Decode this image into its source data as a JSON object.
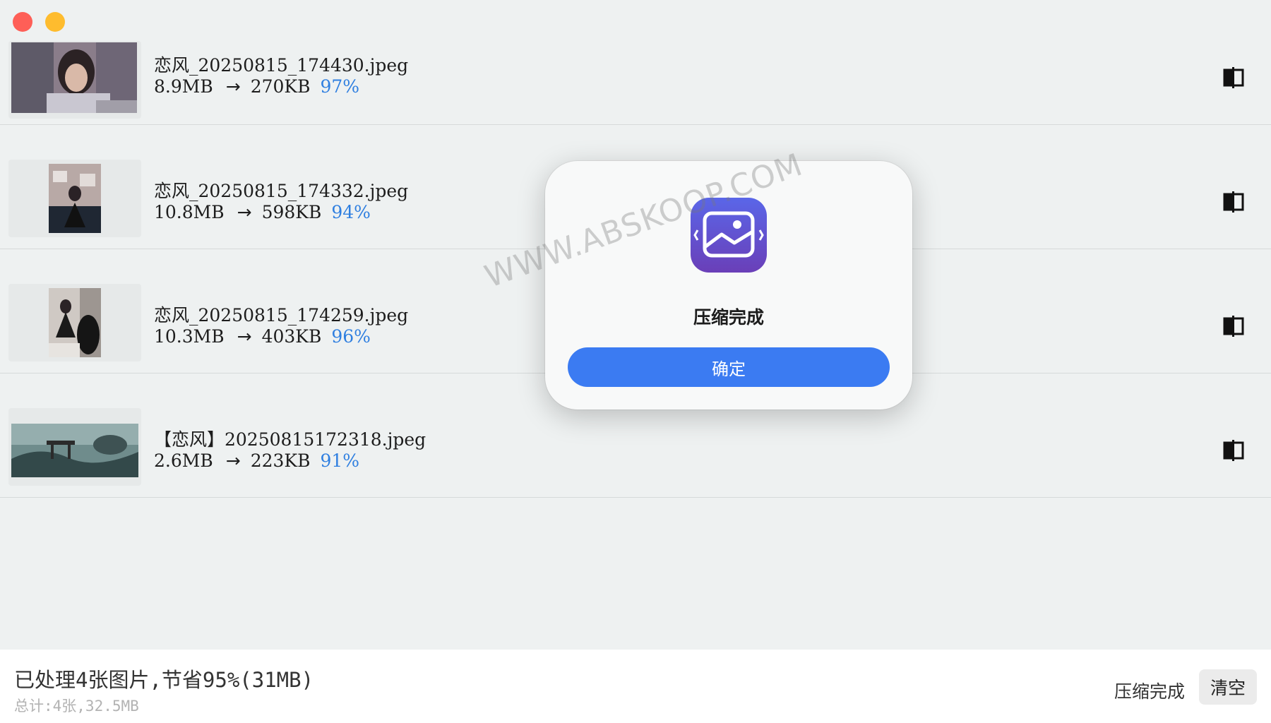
{
  "window": {
    "controls": [
      "close",
      "minimize"
    ]
  },
  "files": [
    {
      "name": "恋风_20250815_174430.jpeg",
      "original_size": "8.9MB",
      "arrow": "→",
      "compressed_size": "270KB",
      "ratio": "97%",
      "thumbnail": "portrait-woman-photo"
    },
    {
      "name": "恋风_20250815_174332.jpeg",
      "original_size": "10.8MB",
      "arrow": "→",
      "compressed_size": "598KB",
      "ratio": "94%",
      "thumbnail": "portrait-room-photo"
    },
    {
      "name": "恋风_20250815_174259.jpeg",
      "original_size": "10.3MB",
      "arrow": "→",
      "compressed_size": "403KB",
      "ratio": "96%",
      "thumbnail": "portrait-sitting-photo"
    },
    {
      "name": "【恋风】20250815172318.jpeg",
      "original_size": "2.6MB",
      "arrow": "→",
      "compressed_size": "223KB",
      "ratio": "91%",
      "thumbnail": "landscape-pavilion-photo"
    }
  ],
  "status": {
    "summary": "已处理4张图片,节省95%(31MB)",
    "total": "总计:4张,32.5MB",
    "state": "压缩完成",
    "clear_label": "清空"
  },
  "modal": {
    "title": "压缩完成",
    "ok_label": "确定",
    "icon": "image-compress-app-icon"
  },
  "watermark": "WWW.ABSKOOP.COM",
  "colors": {
    "accent": "#3b7bf2",
    "ratio": "#2f7fe0",
    "close": "#fe5f57",
    "minimize": "#febc2e",
    "app_icon_top": "#5a66e8",
    "app_icon_bottom": "#6a3fb8"
  }
}
